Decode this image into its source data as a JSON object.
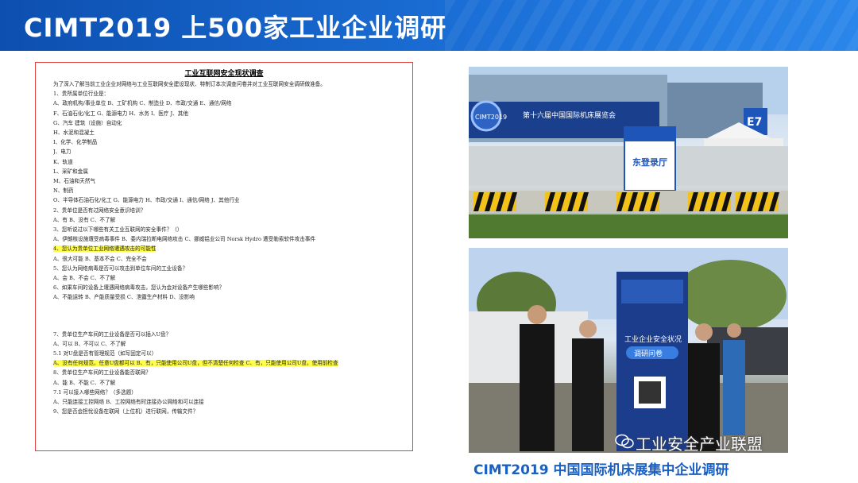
{
  "header": {
    "title": "CIMT2019 上500家工业企业调研"
  },
  "survey": {
    "title": "工业互联网安全现状调查",
    "lines": [
      "为了深入了解当前工业企业对网络与工业互联网安全建设现状、特制订本次调查问卷并对工业互联网安全调研做准备。",
      "1、贵所属单位行业是：",
      "A、政府机构/事业单位    B、工矿机构    C、制造业    D、市政/交通    E、通信/网络",
      "F、石油石化/化工    G、能源电力    H、水务    I、医疗    J、其他",
      "G、汽车  建筑（设施）自动化",
      "H、水泥和混凝土",
      "I、化学、化学制品",
      "J、电力",
      "K、轨道",
      "L、采矿和金属",
      "M、石油和天然气",
      "N、制药",
      "O、半导体石油石化/化工  G、能源电力  H、市政/交通  I、通信/网络  J、其他行业",
      "2、贵单位是否有过网络安全意识培训？",
      "A、有  B、没有  C、不了解",
      "3、您听说过以下哪些有关工业互联网的安全事件？（）",
      "A、伊朗核设施遭受病毒事件  B、委内瑞拉断电网络攻击  C、挪威铝业公司 Norsk Hydro 遭受勒索软件攻击事件",
      "4、您认为贵单位工业网络遭遇攻击的可能性",
      "A、很大可能  B、基本不会  C、完全不会",
      "5、您认为网络病毒是否可以攻击到单位车间的工业设备？",
      "A、会  B、不会  C、不了解",
      "6、如果车间的设备上遭遇网络病毒攻击，您认为会对设备产生哪些影响？",
      "A、不能运转  B、产能质量受损  C、泄露生产材料  D、没影响"
    ],
    "lines2": [
      "7、贵单位生产车间的工业设备是否可以插入U盘？",
      "A、可以  B、不可以  C、不了解",
      "5.1  对U盘是否有管理规范（如写固定可以）",
      "A、没有任何规范，任意U盘都可以  B、有，只能使用公司U盘，但不清楚任何检查  C、有，只能使用公司U盘，使用前检查",
      "8、贵单位生产车间的工业设备能否联网？",
      "A、能  B、不能  C、不了解",
      "7.1  可以接入哪些网络？（多选题）",
      "A、只能连接工控网络  B、工控网络有时连接办公网络和可以连接",
      "9、您是否会担忧设备在联网（上位机）进行联网，传输文件？"
    ],
    "highlighted": [
      17,
      26
    ]
  },
  "photos": {
    "top_signs": [
      "CIMT2019",
      "第十六届中国国际机床展览会",
      "东登录厅",
      "E7"
    ],
    "banner_text": [
      "工业企业安全状况",
      "调研问卷"
    ]
  },
  "caption": "CIMT2019 中国国际机床展集中企业调研",
  "watermark": "工业安全产业联盟"
}
